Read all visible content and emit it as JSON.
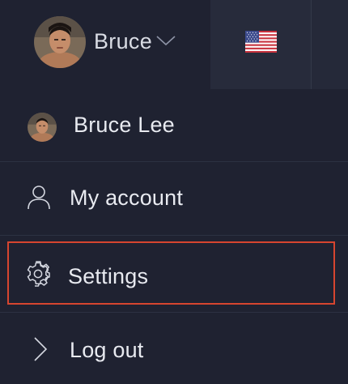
{
  "header": {
    "user_name": "Bruce",
    "avatar": "user-avatar-photo",
    "dropdown_icon": "chevron-down-icon",
    "language_flag": "us-flag-icon"
  },
  "menu": {
    "profile_name": "Bruce Lee",
    "items": [
      {
        "label": "My account",
        "icon": "user-icon"
      },
      {
        "label": "Settings",
        "icon": "gear-icon"
      },
      {
        "label": "Log out",
        "icon": "chevron-right-icon"
      }
    ]
  },
  "colors": {
    "background": "#1f2231",
    "active_tab": "#272b3b",
    "text": "#e8eaf0",
    "highlight": "#d6452f"
  }
}
